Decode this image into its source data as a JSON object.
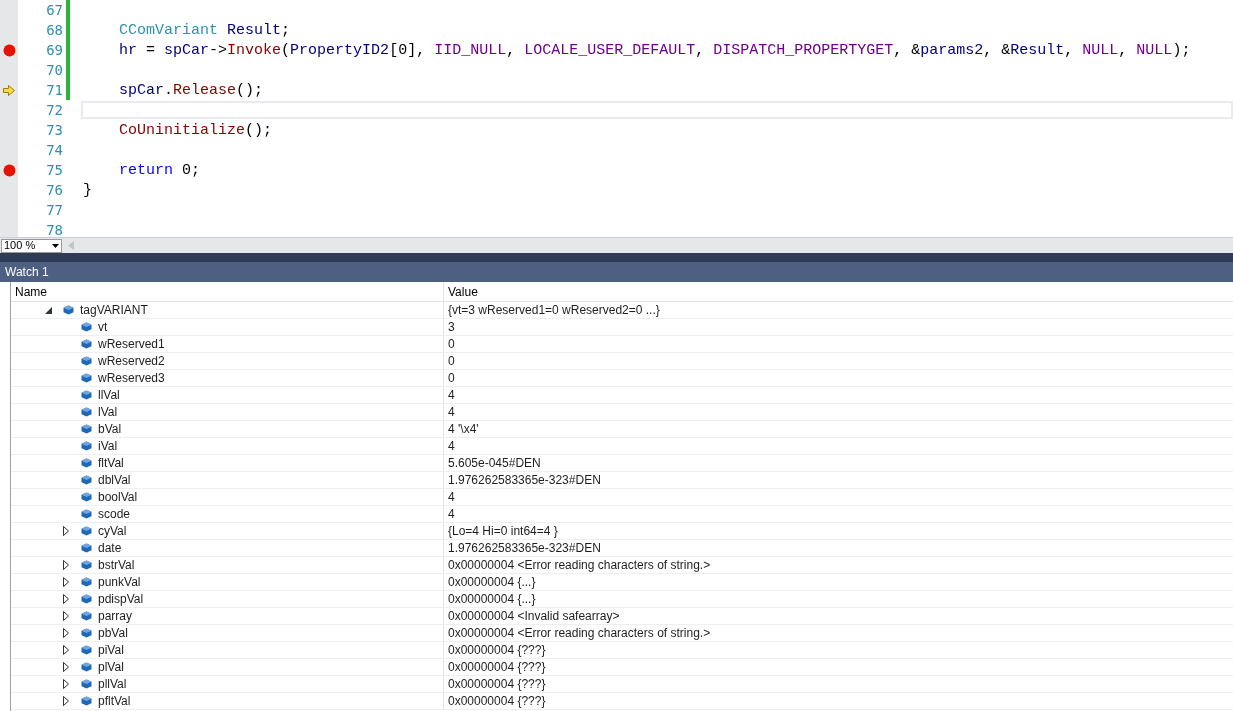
{
  "editor": {
    "lines": [
      {
        "number": "67",
        "breakpoint": false,
        "current": false,
        "modified": true,
        "caret_line": false
      },
      {
        "number": "68",
        "breakpoint": false,
        "current": false,
        "modified": true,
        "caret_line": false,
        "indented": true,
        "tokens": [
          {
            "text": "CComVariant ",
            "kind": "type"
          },
          {
            "text": "Result",
            "kind": "ident"
          },
          {
            "text": ";",
            "kind": "plain"
          }
        ]
      },
      {
        "number": "69",
        "breakpoint": true,
        "current": false,
        "modified": true,
        "caret_line": false,
        "indented": true,
        "tokens": [
          {
            "text": "hr",
            "kind": "ident"
          },
          {
            "text": " = ",
            "kind": "plain"
          },
          {
            "text": "spCar",
            "kind": "ident"
          },
          {
            "text": "->",
            "kind": "plain"
          },
          {
            "text": "Invoke",
            "kind": "func"
          },
          {
            "text": "(",
            "kind": "plain"
          },
          {
            "text": "PropertyID2",
            "kind": "ident"
          },
          {
            "text": "[0], ",
            "kind": "plain"
          },
          {
            "text": "IID_NULL",
            "kind": "macro"
          },
          {
            "text": ", ",
            "kind": "plain"
          },
          {
            "text": "LOCALE_USER_DEFAULT",
            "kind": "macro"
          },
          {
            "text": ", ",
            "kind": "plain"
          },
          {
            "text": "DISPATCH_PROPERTYGET",
            "kind": "macro"
          },
          {
            "text": ", &",
            "kind": "plain"
          },
          {
            "text": "params2",
            "kind": "ident"
          },
          {
            "text": ", &",
            "kind": "plain"
          },
          {
            "text": "Result",
            "kind": "ident"
          },
          {
            "text": ", ",
            "kind": "plain"
          },
          {
            "text": "NULL",
            "kind": "macro"
          },
          {
            "text": ", ",
            "kind": "plain"
          },
          {
            "text": "NULL",
            "kind": "macro"
          },
          {
            "text": ");",
            "kind": "plain"
          }
        ]
      },
      {
        "number": "70",
        "breakpoint": false,
        "current": false,
        "modified": true,
        "caret_line": false
      },
      {
        "number": "71",
        "breakpoint": false,
        "current": true,
        "modified": true,
        "caret_line": false,
        "indented": true,
        "tokens": [
          {
            "text": "spCar",
            "kind": "ident"
          },
          {
            "text": ".",
            "kind": "plain"
          },
          {
            "text": "Release",
            "kind": "func"
          },
          {
            "text": "();",
            "kind": "plain"
          }
        ]
      },
      {
        "number": "72",
        "breakpoint": false,
        "current": false,
        "modified": false,
        "caret_line": true
      },
      {
        "number": "73",
        "breakpoint": false,
        "current": false,
        "modified": false,
        "caret_line": false,
        "indented": true,
        "tokens": [
          {
            "text": "CoUninitialize",
            "kind": "func"
          },
          {
            "text": "();",
            "kind": "plain"
          }
        ]
      },
      {
        "number": "74",
        "breakpoint": false,
        "current": false,
        "modified": false,
        "caret_line": false
      },
      {
        "number": "75",
        "breakpoint": true,
        "current": false,
        "modified": false,
        "caret_line": false,
        "indented": true,
        "tokens": [
          {
            "text": "return",
            "kind": "keyword"
          },
          {
            "text": " 0;",
            "kind": "plain"
          }
        ]
      },
      {
        "number": "76",
        "breakpoint": false,
        "current": false,
        "modified": false,
        "caret_line": false,
        "indented": false,
        "tokens": [
          {
            "text": "}",
            "kind": "plain"
          }
        ]
      },
      {
        "number": "77",
        "breakpoint": false,
        "current": false,
        "modified": false,
        "caret_line": false
      },
      {
        "number": "78",
        "breakpoint": false,
        "current": false,
        "modified": false,
        "caret_line": false
      }
    ],
    "zoom": "100 %"
  },
  "watch": {
    "title": "Watch 1",
    "columns": [
      "Name",
      "Value"
    ],
    "rows": [
      {
        "name": "tagVARIANT",
        "value": "{vt=3 wReserved1=0 wReserved2=0 ...}",
        "expanded": true,
        "children": [
          {
            "name": "vt",
            "value": "3"
          },
          {
            "name": "wReserved1",
            "value": "0"
          },
          {
            "name": "wReserved2",
            "value": "0"
          },
          {
            "name": "wReserved3",
            "value": "0"
          },
          {
            "name": "llVal",
            "value": "4"
          },
          {
            "name": "lVal",
            "value": "4"
          },
          {
            "name": "bVal",
            "value": "4 '\\x4'"
          },
          {
            "name": "iVal",
            "value": "4"
          },
          {
            "name": "fltVal",
            "value": "5.605e-045#DEN"
          },
          {
            "name": "dblVal",
            "value": "1.976262583365e-323#DEN"
          },
          {
            "name": "boolVal",
            "value": "4"
          },
          {
            "name": "scode",
            "value": "4"
          },
          {
            "name": "cyVal",
            "value": "{Lo=4 Hi=0 int64=4 }",
            "expanded": false
          },
          {
            "name": "date",
            "value": "1.976262583365e-323#DEN"
          },
          {
            "name": "bstrVal",
            "value": "0x00000004 <Error reading characters of string.>",
            "expanded": false
          },
          {
            "name": "punkVal",
            "value": "0x00000004 {...}",
            "expanded": false
          },
          {
            "name": "pdispVal",
            "value": "0x00000004 {...}",
            "expanded": false
          },
          {
            "name": "parray",
            "value": "0x00000004 <Invalid safearray>",
            "expanded": false
          },
          {
            "name": "pbVal",
            "value": "0x00000004 <Error reading characters of string.>",
            "expanded": false
          },
          {
            "name": "piVal",
            "value": "0x00000004 {???}",
            "expanded": false
          },
          {
            "name": "plVal",
            "value": "0x00000004 {???}",
            "expanded": false
          },
          {
            "name": "pllVal",
            "value": "0x00000004 {???}",
            "expanded": false
          },
          {
            "name": "pfltVal",
            "value": "0x00000004 {???}",
            "expanded": false
          }
        ]
      }
    ]
  }
}
